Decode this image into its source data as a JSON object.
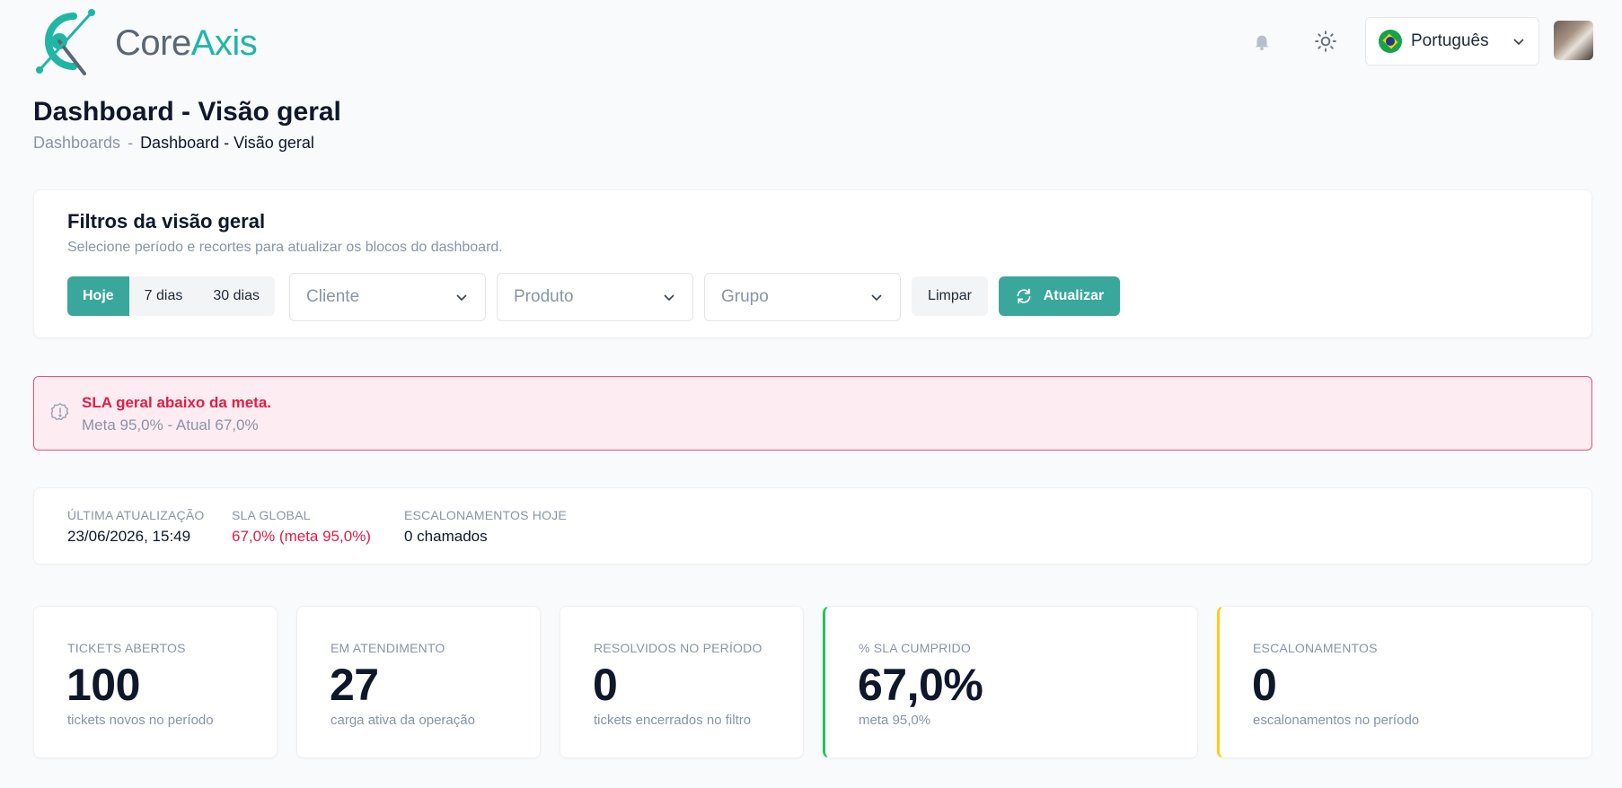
{
  "brand": {
    "name_part1": "Core",
    "name_part2": "Axis",
    "accent": "#1fb6a6"
  },
  "header": {
    "notification_icon": "bell-icon",
    "theme_icon": "sun-icon",
    "language": {
      "label": "Português",
      "flag": "brazil-flag-icon"
    },
    "avatar": "user-avatar"
  },
  "page": {
    "title": "Dashboard - Visão geral",
    "breadcrumb": {
      "parent": "Dashboards",
      "separator": "-",
      "current": "Dashboard - Visão geral"
    }
  },
  "filters": {
    "title": "Filtros da visão geral",
    "subtitle": "Selecione período e recortes para atualizar os blocos do dashboard.",
    "periods": [
      {
        "label": "Hoje",
        "active": true
      },
      {
        "label": "7 dias",
        "active": false
      },
      {
        "label": "30 dias",
        "active": false
      }
    ],
    "selects": {
      "client_placeholder": "Cliente",
      "product_placeholder": "Produto",
      "group_placeholder": "Grupo"
    },
    "clear_label": "Limpar",
    "refresh_label": "Atualizar",
    "primary_color": "#3aa79c"
  },
  "alert": {
    "title": "SLA geral abaixo da meta.",
    "description": "Meta 95,0% - Atual 67,0%",
    "color": "#e11d48"
  },
  "status": {
    "last_update": {
      "label": "ÚLTIMA ATUALIZAÇÃO",
      "value": "23/06/2026, 15:49"
    },
    "sla_global": {
      "label": "SLA GLOBAL",
      "value": "67,0% (meta 95,0%)"
    },
    "escalations_today": {
      "label": "ESCALONAMENTOS HOJE",
      "value": "0 chamados"
    }
  },
  "kpis": [
    {
      "label": "TICKETS ABERTOS",
      "value": "100",
      "sub": "tickets novos no período"
    },
    {
      "label": "EM ATENDIMENTO",
      "value": "27",
      "sub": "carga ativa da operação"
    },
    {
      "label": "RESOLVIDOS NO PERÍODO",
      "value": "0",
      "sub": "tickets encerrados no filtro"
    },
    {
      "label": "% SLA CUMPRIDO",
      "value": "67,0%",
      "sub": "meta 95,0%",
      "accent": "#22c55e"
    },
    {
      "label": "ESCALONAMENTOS",
      "value": "0",
      "sub": "escalonamentos no período",
      "accent": "#facc15"
    }
  ]
}
